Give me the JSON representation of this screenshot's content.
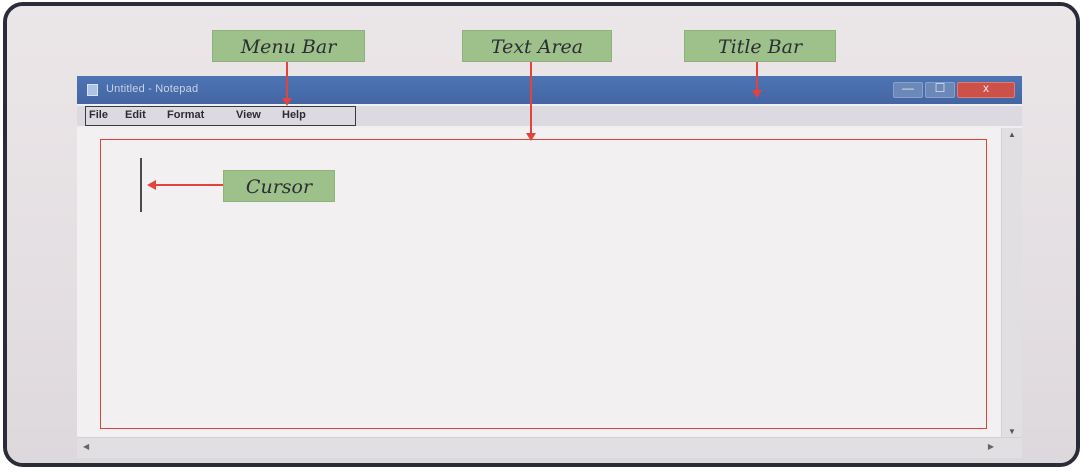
{
  "callouts": {
    "menu_bar": "Menu Bar",
    "text_area": "Text Area",
    "title_bar": "Title Bar",
    "cursor": "Cursor"
  },
  "window": {
    "title": "Untitled - Notepad",
    "controls": {
      "minimize": "—",
      "maximize": "☐",
      "close": "x"
    }
  },
  "menu": {
    "items": [
      "File",
      "Edit",
      "Format",
      "View",
      "Help"
    ]
  },
  "icons": {
    "app": "notepad-icon",
    "scroll_up": "arrow-up-icon",
    "scroll_down": "arrow-down-icon",
    "scroll_left": "arrow-left-icon",
    "scroll_right": "arrow-right-icon"
  },
  "colors": {
    "callout_fill": "#9ec08a",
    "arrow": "#e0443c",
    "titlebar": "#4465a3",
    "close_button": "#cc5148"
  }
}
